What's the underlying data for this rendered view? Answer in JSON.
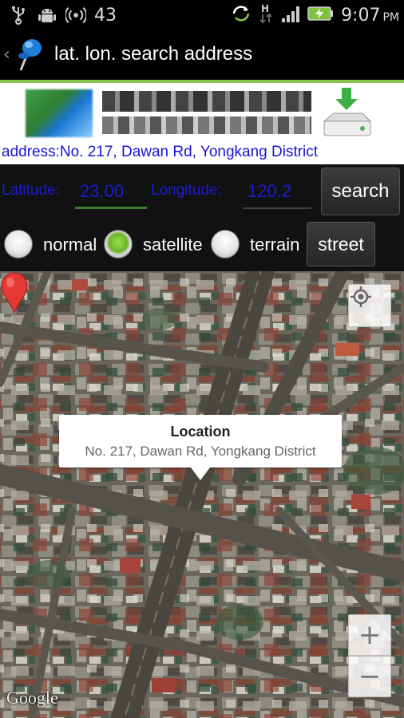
{
  "status_bar": {
    "notification_count": "43",
    "time": "9:07",
    "ampm": "PM",
    "icons": [
      "usb-icon",
      "android-debug-icon",
      "hotspot-icon",
      "sync-icon",
      "data-h-icon",
      "signal-icon",
      "battery-charging-icon"
    ]
  },
  "action_bar": {
    "title": "lat. lon. search address",
    "icon": "map-pin-icon",
    "accent_color": "#8bc34a"
  },
  "ad_banner": {
    "icon": "download-drive-icon"
  },
  "address_line": {
    "text": "address:No. 217, Dawan Rd, Yongkang District",
    "color": "#1a12d4"
  },
  "coords": {
    "latitude_label": "Latitude:",
    "latitude_value": "23.00",
    "longitude_label": "Longitude:",
    "longitude_value": "120.2",
    "search_label": "search"
  },
  "map_type": {
    "options": [
      {
        "label": "normal",
        "checked": false
      },
      {
        "label": "satellite",
        "checked": true
      },
      {
        "label": "terrain",
        "checked": false
      }
    ],
    "street_label": "street"
  },
  "map": {
    "info_title": "Location",
    "info_address": "No. 217, Dawan Rd, Yongkang District",
    "zoom_in": "+",
    "zoom_out": "−",
    "attribution": "Google",
    "marker_color": "#e53935"
  }
}
